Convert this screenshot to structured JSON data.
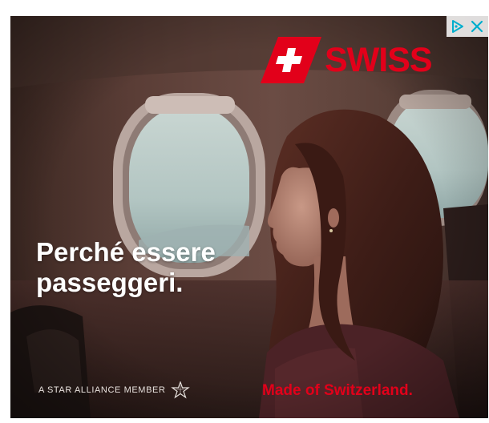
{
  "ad": {
    "brand": "SWISS",
    "headline": {
      "line1": "Perché essere",
      "line2": "passeggeri."
    },
    "alliance_text": "A STAR ALLIANCE MEMBER",
    "tagline": "Made of Switzerland.",
    "colors": {
      "brand_red": "#e2001a",
      "text_white": "#ffffff",
      "adchoices_blue": "#00aecd"
    }
  },
  "adchoices": {
    "icons": [
      "adchoices-icon",
      "close-icon"
    ]
  }
}
